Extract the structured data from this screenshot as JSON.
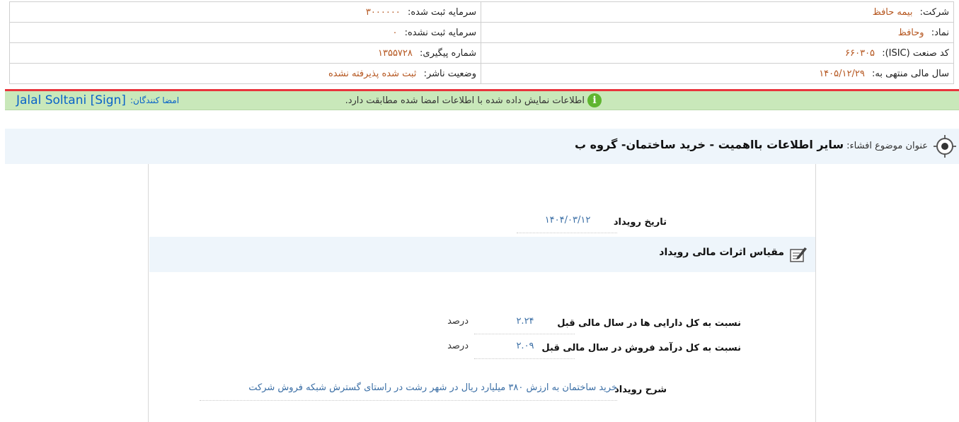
{
  "header": {
    "company_label": "شرکت:",
    "company_value": "بیمه حافظ",
    "registered_capital_label": "سرمایه ثبت شده:",
    "registered_capital_value": "۳۰۰۰۰۰۰",
    "symbol_label": "نماد:",
    "symbol_value": "وحافظ",
    "unregistered_capital_label": "سرمایه ثبت نشده:",
    "unregistered_capital_value": "۰",
    "isic_label": "کد صنعت (ISIC):",
    "isic_value": "۶۶۰۳۰۵",
    "tracking_label": "شماره پیگیری:",
    "tracking_value": "۱۳۵۵۷۲۸",
    "fiscal_year_label": "سال مالی منتهی به:",
    "fiscal_year_value": "۱۴۰۵/۱۲/۲۹",
    "publisher_status_label": "وضعیت ناشر:",
    "publisher_status_value": "ثبت شده پذیرفته نشده"
  },
  "sign_bar": {
    "message": "اطلاعات نمایش داده شده با اطلاعات امضا شده مطابقت دارد.",
    "signers_label": "امضا کنندگان:",
    "signer_name": "Jalal Soltani [Sign]"
  },
  "subject": {
    "label": "عنوان موضوع افشاء:",
    "title": "سایر اطلاعات بااهمیت - خرید ساختمان- گروه ب"
  },
  "content": {
    "event_date_label": "تاریخ رویداد",
    "event_date_value": "۱۴۰۴/۰۳/۱۲",
    "section_title": "مقیاس اثرات مالی رویداد",
    "assets_ratio_label": "نسبت به کل دارایی ها در سال مالی قبل",
    "assets_ratio_value": "۲.۲۴",
    "assets_ratio_unit": "درصد",
    "revenue_ratio_label": "نسبت به کل درآمد فروش در سال مالی قبل",
    "revenue_ratio_value": "۲.۰۹",
    "revenue_ratio_unit": "درصد",
    "description_label": "شرح رویداد",
    "description_value": "خرید ساختمان به ارزش ۳۸۰ میلیارد ریال در شهر رشت در راستای گسترش شبکه فروش شرکت"
  },
  "colors": {
    "value_orange": "#b5561f",
    "value_blue": "#3a6ea5",
    "signer_blue": "#0a63c9",
    "sign_bar_green": "#c9e8ba",
    "red_line": "#e8343c",
    "subject_bg": "#eef5fb"
  },
  "icons": {
    "info": "info-icon",
    "target": "target-icon",
    "edit": "edit-note-icon"
  }
}
